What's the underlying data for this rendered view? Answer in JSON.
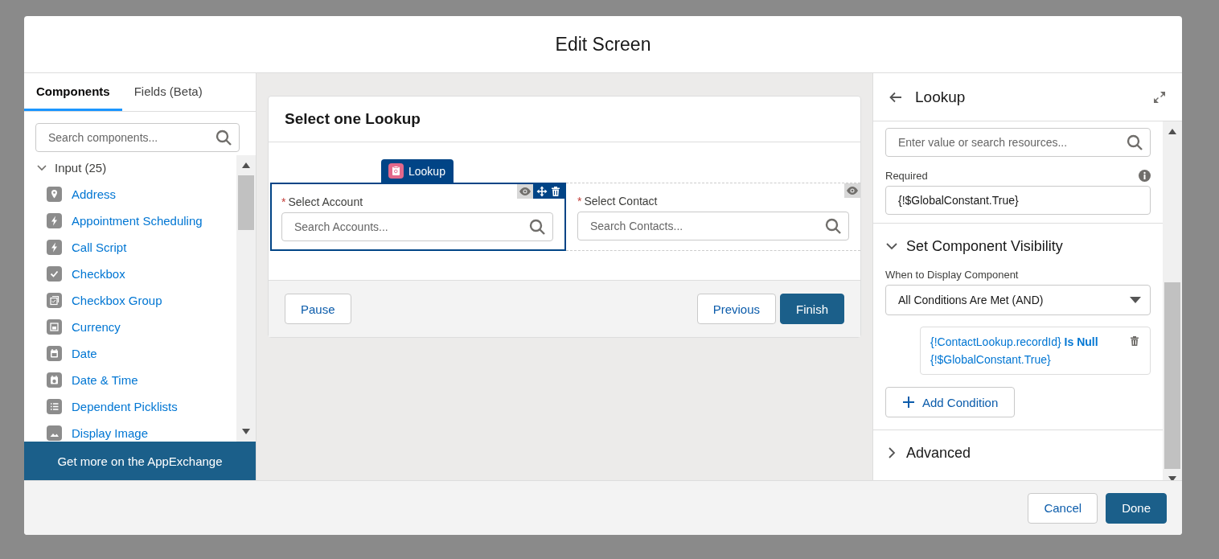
{
  "window": {
    "title": "Edit Screen"
  },
  "left_panel": {
    "tabs": [
      {
        "label": "Components",
        "selected": true
      },
      {
        "label": "Fields (Beta)",
        "selected": false
      }
    ],
    "search": {
      "placeholder": "Search components..."
    },
    "group": {
      "label": "Input (25)",
      "expanded": true,
      "items": [
        {
          "label": "Address",
          "kind": "location"
        },
        {
          "label": "Appointment Scheduling",
          "kind": "bolt"
        },
        {
          "label": "Call Script",
          "kind": "bolt"
        },
        {
          "label": "Checkbox",
          "kind": "check"
        },
        {
          "label": "Checkbox Group",
          "kind": "checkgroup"
        },
        {
          "label": "Currency",
          "kind": "square"
        },
        {
          "label": "Date",
          "kind": "date"
        },
        {
          "label": "Date & Time",
          "kind": "datetime"
        },
        {
          "label": "Dependent Picklists",
          "kind": "list"
        },
        {
          "label": "Display Image",
          "kind": "image"
        }
      ]
    },
    "footer_link": "Get more on the AppExchange"
  },
  "canvas": {
    "screen_title": "Select one Lookup",
    "component_tag": "Lookup",
    "fields": [
      {
        "label": "Select Account",
        "required_marker": "*",
        "placeholder": "Search Accounts...",
        "selected": true
      },
      {
        "label": "Select Contact",
        "required_marker": "*",
        "placeholder": "Search Contacts...",
        "selected": false
      }
    ],
    "left_buttons": [
      {
        "label": "Pause",
        "kind": "neutral"
      }
    ],
    "right_buttons": [
      {
        "label": "Previous",
        "kind": "neutral"
      },
      {
        "label": "Finish",
        "kind": "brand"
      }
    ]
  },
  "properties": {
    "title": "Lookup",
    "value_field": {
      "placeholder": "Enter value or search resources..."
    },
    "required": {
      "label": "Required",
      "value": "{!$GlobalConstant.True}"
    },
    "sections": [
      {
        "title": "Set Component Visibility",
        "expanded": true
      },
      {
        "title": "Advanced",
        "expanded": false
      }
    ],
    "visibility": {
      "label": "When to Display Component",
      "select": "All Conditions Are Met (AND)",
      "conditions": [
        "{!ContactLookup.recordId} **Is Null** {!$GlobalConstant.True}"
      ],
      "add_button": "Add Condition"
    }
  },
  "footer": {
    "buttons": [
      {
        "label": "Cancel",
        "kind": "neutral"
      },
      {
        "label": "Done",
        "kind": "brand"
      }
    ]
  }
}
